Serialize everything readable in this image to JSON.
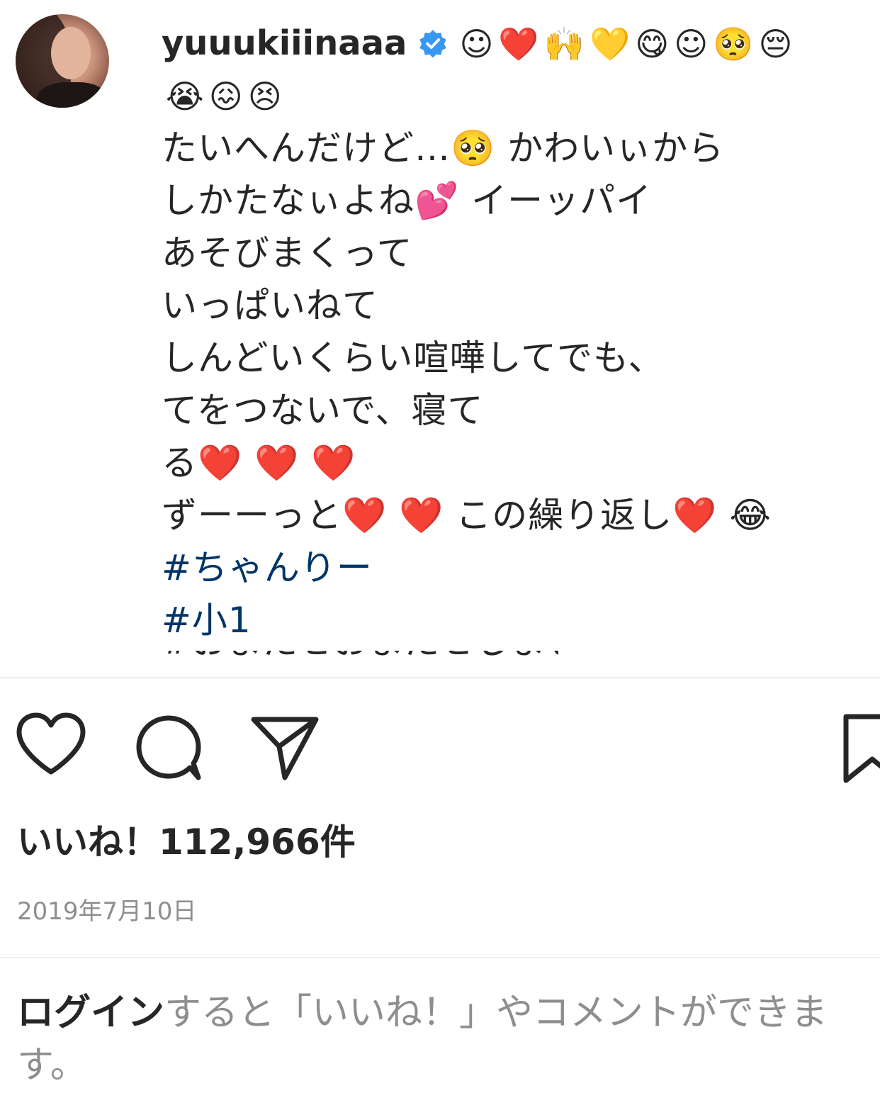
{
  "post": {
    "username": "yuuukiiinaaa",
    "verified": true,
    "caption_lines": [
      {
        "text": "",
        "emojis": [
          "☺",
          "❤️",
          "🙌",
          "💛",
          "😋",
          "☺",
          "🥺",
          "😔"
        ]
      },
      {
        "text": "",
        "emojis": [
          "😭",
          "😖",
          "😣"
        ]
      },
      {
        "text": "たいへんだけど…🥺 かわいぃから"
      },
      {
        "text": "しかたなぃよね💕 イーッパイ"
      },
      {
        "text": "あそびまくって"
      },
      {
        "text": "いっぱいねて"
      },
      {
        "text": "しんどいくらい喧嘩してでも、"
      },
      {
        "text": "てをつないで、寝て"
      },
      {
        "text": "る❤️ ❤️ ❤️"
      },
      {
        "text": "ずーーっと❤️ ❤️ この繰り返し❤️ 😂"
      }
    ],
    "hashtags": [
      "#ちゃんりー",
      "#小1"
    ],
    "truncated_line": "#おまたせおまたせしました"
  },
  "actions": {
    "like_icon": "heart-outline-icon",
    "comment_icon": "comment-bubble-icon",
    "share_icon": "paper-plane-icon",
    "save_icon": "bookmark-icon"
  },
  "likes": {
    "label": "いいね！112,966件"
  },
  "date": "2019年7月10日",
  "login_prompt": {
    "link_text": "ログイン",
    "rest_text": "すると「いいね！」やコメントができます。"
  },
  "colors": {
    "text": "#262626",
    "secondary": "#8e8e8e",
    "hashtag": "#003569",
    "verified": "#3897f0",
    "divider": "#efefef"
  }
}
